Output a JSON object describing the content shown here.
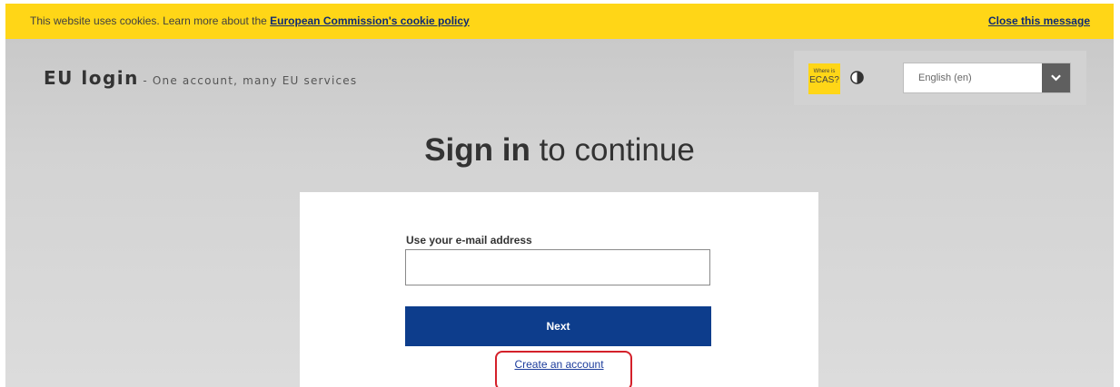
{
  "cookie_banner": {
    "text": "This website uses cookies. Learn more about the",
    "policy_link": "European Commission's cookie policy",
    "close_label": "Close this message",
    "background": "#ffd617"
  },
  "header": {
    "brand_name": "EU login",
    "tagline": "- One account, many EU services",
    "ecas_badge": {
      "line1": "Where is",
      "line2": "ECAS?"
    },
    "contrast_icon": "contrast-icon",
    "language_select": {
      "selected": "English (en)",
      "icon": "chevron-down-icon"
    }
  },
  "main": {
    "title_bold": "Sign in",
    "title_rest": " to continue",
    "email_label": "Use your e-mail address",
    "email_value": "",
    "next_label": "Next",
    "create_account_label": "Create an account"
  },
  "colors": {
    "primary_button": "#0d3d8c",
    "accent_yellow": "#ffd617",
    "highlight_outline": "#d4202a"
  }
}
